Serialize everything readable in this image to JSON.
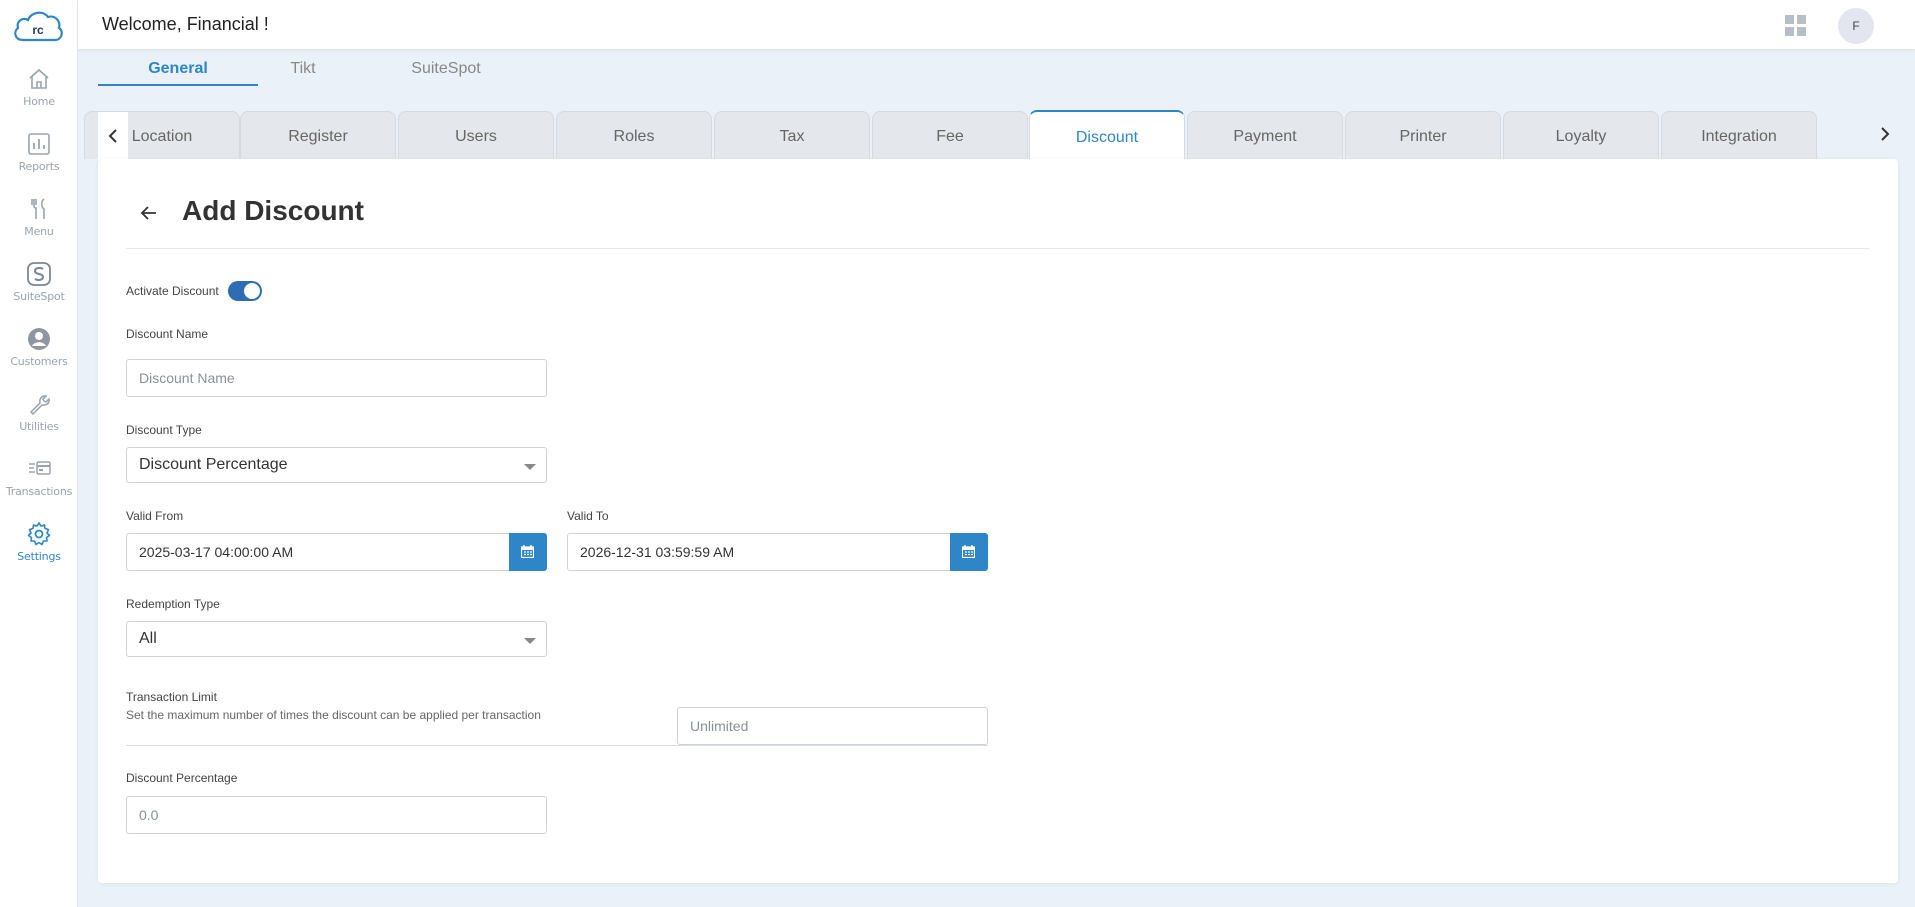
{
  "header": {
    "welcome": "Welcome, Financial !",
    "avatar_initial": "F"
  },
  "sidebar": {
    "logo_text": "rc",
    "items": [
      {
        "label": "Home",
        "icon": "home-icon"
      },
      {
        "label": "Reports",
        "icon": "reports-icon"
      },
      {
        "label": "Menu",
        "icon": "menu-utensils-icon"
      },
      {
        "label": "SuiteSpot",
        "icon": "suitespot-icon"
      },
      {
        "label": "Customers",
        "icon": "customers-icon"
      },
      {
        "label": "Utilities",
        "icon": "wrench-icon"
      },
      {
        "label": "Transactions",
        "icon": "transactions-icon"
      },
      {
        "label": "Settings",
        "icon": "gear-icon",
        "active": true
      }
    ]
  },
  "top_tabs": [
    {
      "label": "General",
      "active": true
    },
    {
      "label": "Tikt"
    },
    {
      "label": "SuiteSpot"
    }
  ],
  "settings_tabs": [
    "Location",
    "Register",
    "Users",
    "Roles",
    "Tax",
    "Fee",
    "Discount",
    "Payment",
    "Printer",
    "Loyalty",
    "Integration"
  ],
  "settings_tab_active": "Discount",
  "form": {
    "title": "Add Discount",
    "activate_label": "Activate Discount",
    "activate_on": true,
    "name_label": "Discount Name",
    "name_placeholder": "Discount Name",
    "type_label": "Discount Type",
    "type_value": "Discount Percentage",
    "valid_from_label": "Valid From",
    "valid_from_value": "2025-03-17 04:00:00 AM",
    "valid_to_label": "Valid To",
    "valid_to_value": "2026-12-31 03:59:59 AM",
    "redemption_label": "Redemption Type",
    "redemption_value": "All",
    "transaction_limit_label": "Transaction Limit",
    "transaction_limit_desc": "Set the maximum number of times the discount can be applied per transaction",
    "transaction_limit_placeholder": "Unlimited",
    "percentage_label": "Discount Percentage",
    "percentage_placeholder": "0.0"
  },
  "colors": {
    "accent": "#2e86c8",
    "toggle": "#2e6db5",
    "background": "#eaf1f8"
  }
}
